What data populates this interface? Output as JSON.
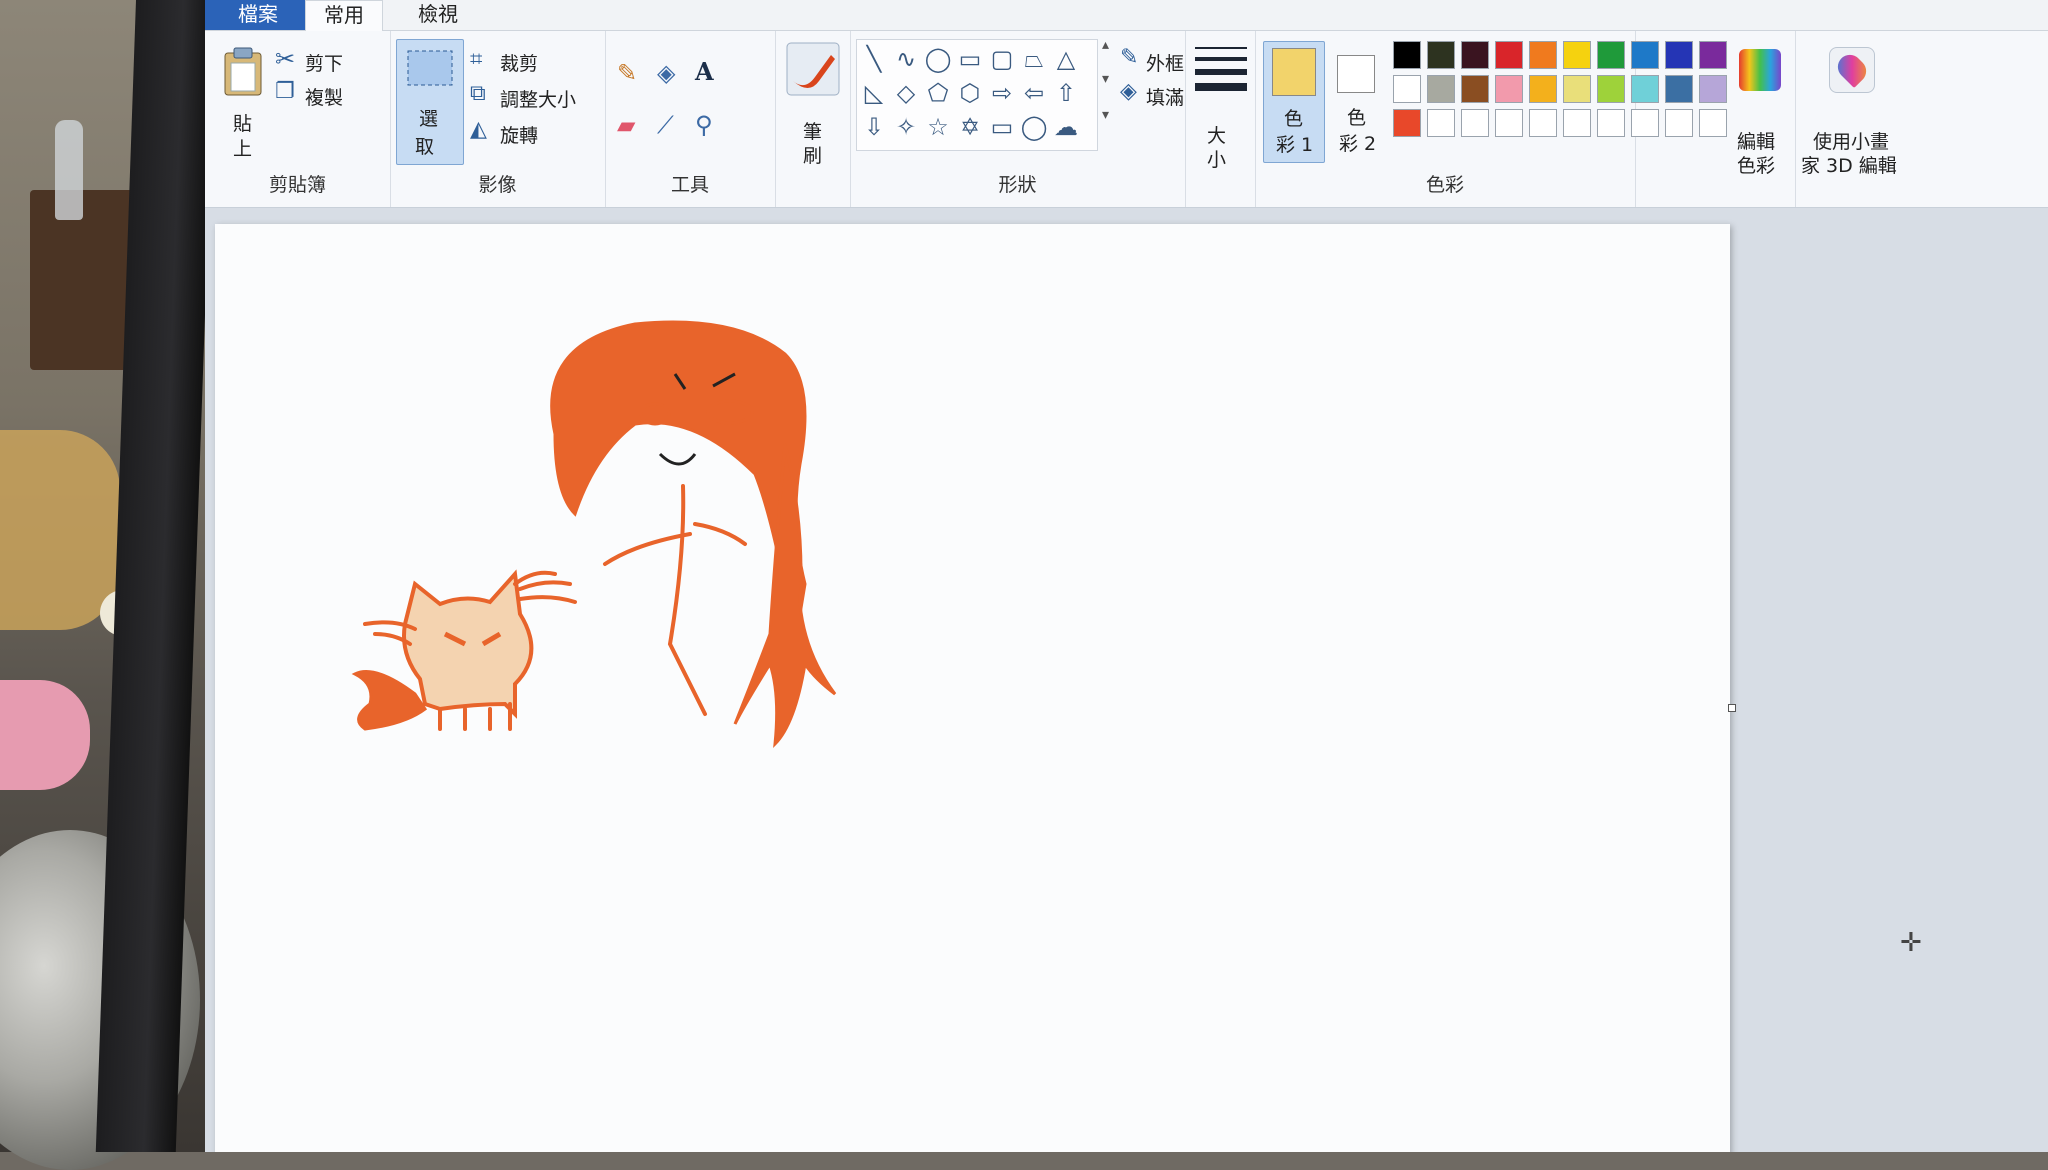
{
  "tabs": {
    "file": "檔案",
    "home": "常用",
    "view": "檢視"
  },
  "clipboard": {
    "paste_top": "貼",
    "paste_bottom": "上",
    "cut": "剪下",
    "copy": "複製",
    "group": "剪貼簿"
  },
  "image": {
    "select_top": "選",
    "select_bottom": "取",
    "crop": "裁剪",
    "resize": "調整大小",
    "rotate": "旋轉",
    "group": "影像"
  },
  "tools": {
    "text_icon": "A",
    "group": "工具"
  },
  "brushes": {
    "top": "筆",
    "bottom": "刷"
  },
  "shapes": {
    "outline": "外框",
    "fill": "填滿",
    "group": "形狀"
  },
  "size": {
    "top": "大",
    "bottom": "小"
  },
  "colors": {
    "color1_top": "色",
    "color1_bottom": "彩 1",
    "color2_top": "色",
    "color2_bottom": "彩 2",
    "group": "色彩",
    "color1_value": "#f2d36b",
    "color2_value": "#ffffff",
    "palette_row1": [
      "#000000",
      "#2d3320",
      "#3a1420",
      "#d9252a",
      "#f07a1e",
      "#f5d20f",
      "#1f9a3a",
      "#1e79c8",
      "#2535b5",
      "#7a2a9c"
    ],
    "palette_row2": [
      "#ffffff",
      "#a7a9a0",
      "#8a4e22",
      "#f29aac",
      "#f3b01c",
      "#e9df7a",
      "#9ed23a",
      "#6fd0d8",
      "#3b6fa3",
      "#b6a6d8"
    ],
    "palette_row3": [
      "#e8482a",
      "#ffffff",
      "#ffffff",
      "#ffffff",
      "#ffffff",
      "#ffffff",
      "#ffffff",
      "#ffffff",
      "#ffffff",
      "#ffffff"
    ]
  },
  "edit_colors": {
    "top": "編輯",
    "bottom": "色彩"
  },
  "paint3d": {
    "top": "使用小畫",
    "bottom": "家 3D 編輯"
  },
  "drawing": {
    "stroke_color": "#e8642b",
    "fill_light": "#f4d3b0"
  }
}
